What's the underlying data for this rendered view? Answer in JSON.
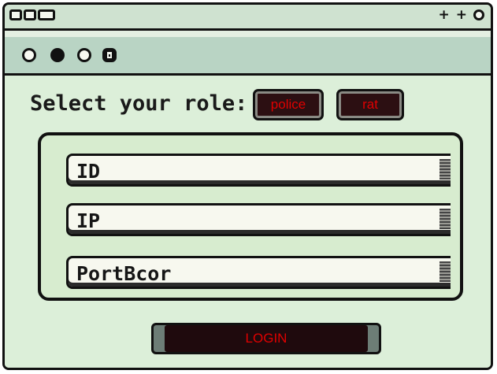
{
  "window": {
    "titlebar_right_glyphs": [
      "+",
      "+"
    ]
  },
  "toolbar": {
    "buttons": [
      {
        "icon": "open-circle-icon"
      },
      {
        "icon": "filled-circle-icon"
      },
      {
        "icon": "open-circle-icon"
      },
      {
        "icon": "trash-icon"
      }
    ]
  },
  "role": {
    "label": "Select your role:",
    "options": [
      {
        "label": "police"
      },
      {
        "label": "rat"
      }
    ]
  },
  "form": {
    "fields": [
      {
        "placeholder": "ID"
      },
      {
        "placeholder": "IP"
      },
      {
        "placeholder": "PortBcor"
      }
    ]
  },
  "login": {
    "label": "LOGIN"
  },
  "colors": {
    "background": "#dcefd9",
    "button_text": "#e00000",
    "button_fill": "#2c0f12",
    "outline": "#111111"
  }
}
